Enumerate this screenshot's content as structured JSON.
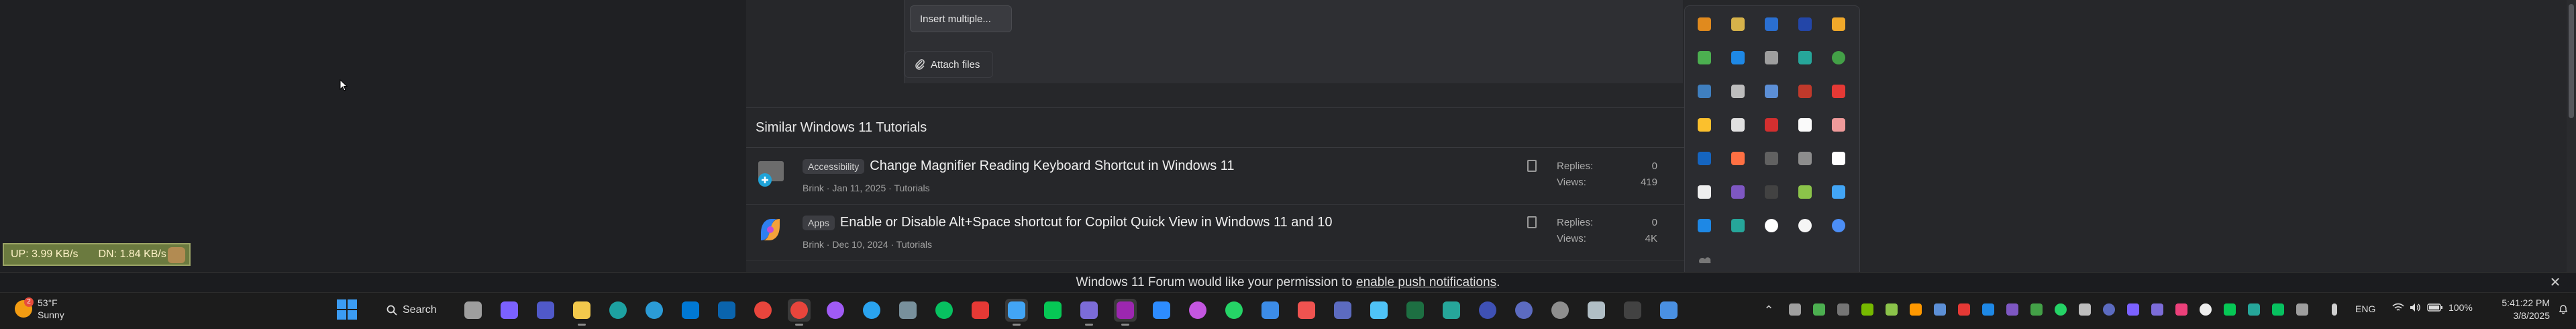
{
  "editor": {
    "insert_multiple_label": "Insert multiple...",
    "attach_files_label": "Attach files"
  },
  "similar": {
    "heading": "Similar Windows 11 Tutorials",
    "rows": [
      {
        "tag": "Accessibility",
        "title": "Change Magnifier Reading Keyboard Shortcut in Windows 11",
        "meta": "Brink · Jan 11, 2025 · Tutorials",
        "replies_label": "Replies:",
        "replies": "0",
        "views_label": "Views:",
        "views": "419"
      },
      {
        "tag": "Apps",
        "title": "Enable or Disable Alt+Space shortcut for Copilot Quick View in Windows 11 and 10",
        "meta": "Brink · Dec 10, 2024 · Tutorials",
        "replies_label": "Replies:",
        "replies": "0",
        "views_label": "Views:",
        "views": "4K"
      }
    ]
  },
  "netmeter": {
    "up": "UP: 3.99 KB/s",
    "down": "DN: 1.84 KB/s"
  },
  "notification": {
    "text": "Windows 11 Forum would like your permission to",
    "link": "enable push notifications",
    "suffix": "."
  },
  "taskbar": {
    "weather_temp": "53°F",
    "weather_cond": "Sunny",
    "weather_badge": "2",
    "search_label": "Search",
    "language": "ENG",
    "battery": "100%",
    "time": "5:41:22 PM",
    "date": "3/8/2025"
  },
  "colors": {
    "accent": "#3b9cf3",
    "page_bg": "#1f2023",
    "panel_bg": "#26272a",
    "taskbar_bg": "#1c1c1c"
  }
}
